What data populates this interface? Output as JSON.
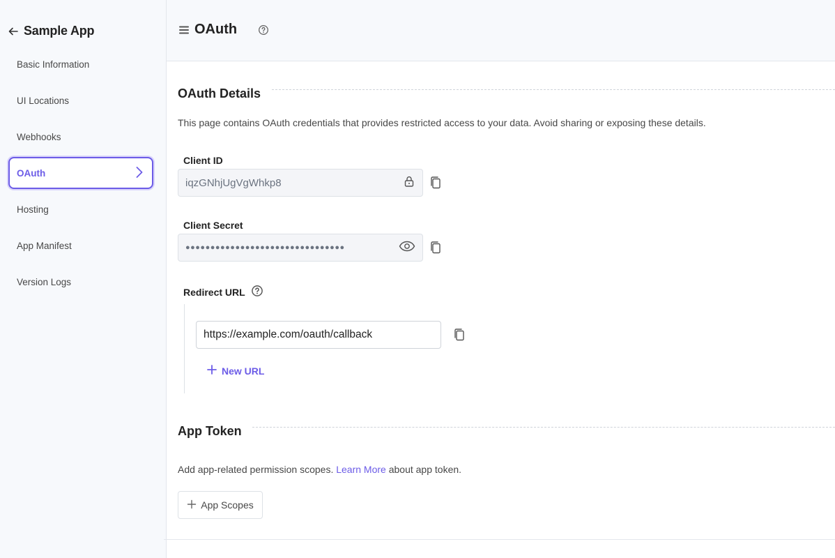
{
  "sidebar": {
    "app_title": "Sample App",
    "items": [
      {
        "label": "Basic Information"
      },
      {
        "label": "UI Locations"
      },
      {
        "label": "Webhooks"
      },
      {
        "label": "OAuth"
      },
      {
        "label": "Hosting"
      },
      {
        "label": "App Manifest"
      },
      {
        "label": "Version Logs"
      }
    ],
    "active_index": 3
  },
  "header": {
    "title": "OAuth"
  },
  "oauth": {
    "section_title": "OAuth Details",
    "description": "This page contains OAuth credentials that provides restricted access to your data. Avoid sharing or exposing these details.",
    "client_id_label": "Client ID",
    "client_id_value": "iqzGNhjUgVgWhkp8",
    "client_secret_label": "Client Secret",
    "client_secret_mask": "●●●●●●●●●●●●●●●●●●●●●●●●●●●●●●●●",
    "redirect_label": "Redirect URL",
    "redirect_url": "https://example.com/oauth/callback",
    "new_url_label": "New URL"
  },
  "app_token": {
    "section_title": "App Token",
    "description_pre": "Add app-related permission scopes.",
    "learn_more": "Learn More",
    "description_post": "about app token.",
    "scopes_button": "App Scopes"
  },
  "colors": {
    "accent": "#6c5ce7",
    "sidebar_bg": "#f7f9fc",
    "border": "#e3e6ec"
  },
  "icons": [
    "back-arrow-icon",
    "hamburger-icon",
    "help-icon",
    "chevron-right-icon",
    "lock-icon",
    "eye-icon",
    "copy-icon",
    "plus-icon"
  ]
}
